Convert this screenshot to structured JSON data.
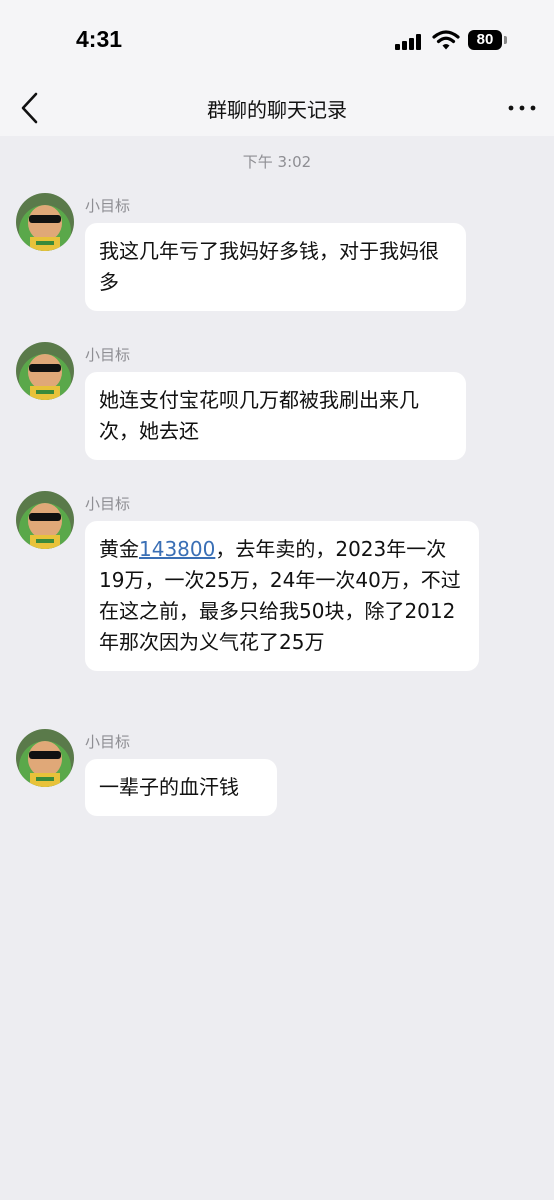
{
  "status_bar": {
    "time": "4:31",
    "battery_level": "80",
    "signal_icon": "cellular-signal-icon",
    "wifi_icon": "wifi-icon"
  },
  "nav": {
    "title": "群聊的聊天记录",
    "back_icon": "chevron-left-icon",
    "more_icon": "more-horizontal-icon"
  },
  "chat": {
    "timestamp": "下午 3:02",
    "messages": [
      {
        "sender": "小目标",
        "text": "我这几年亏了我妈好多钱，对于我妈很多"
      },
      {
        "sender": "小目标",
        "text": "她连支付宝花呗几万都被我刷出来几次，她去还"
      },
      {
        "sender": "小目标",
        "text_before_link": "黄金",
        "link": "143800",
        "text_after_link": "，去年卖的，2023年一次19万，一次25万，24年一次40万，不过在这之前，最多只给我50块，除了2012年那次因为义气花了25万"
      },
      {
        "sender": "小目标",
        "text": "一辈子的血汗钱"
      }
    ]
  },
  "colors": {
    "background": "#ededf1",
    "bubble": "#ffffff",
    "link": "#3a6fb5",
    "meta_text": "#8e8e93"
  }
}
